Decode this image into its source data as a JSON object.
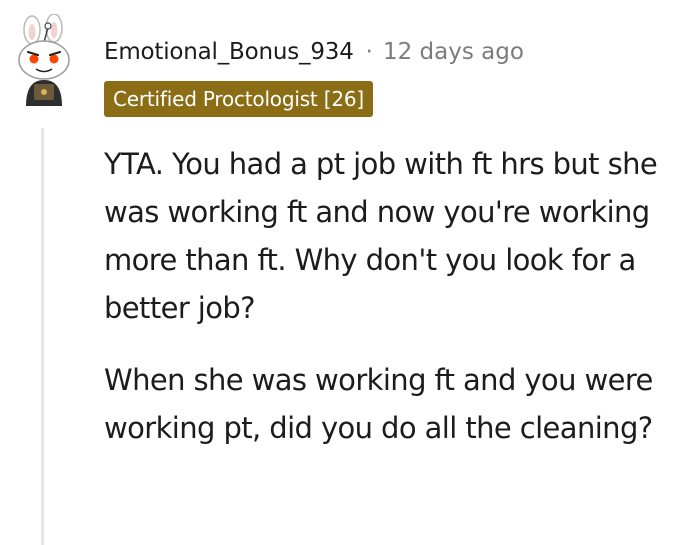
{
  "comment": {
    "username": "Emotional_Bonus_934",
    "separator": "·",
    "timestamp": "12 days ago",
    "flair": {
      "text": "Certified Proctologist [26]",
      "background_color": "#8a6d15"
    },
    "avatar": {
      "icon": "snoo-bunny-avatar-icon"
    },
    "paragraphs": [
      "YTA. You had a pt job with ft hrs but she was working ft and now you're working more than ft. Why don't you look for a better job?",
      "When she was working ft and you were working pt, did you do all the cleaning?"
    ]
  }
}
